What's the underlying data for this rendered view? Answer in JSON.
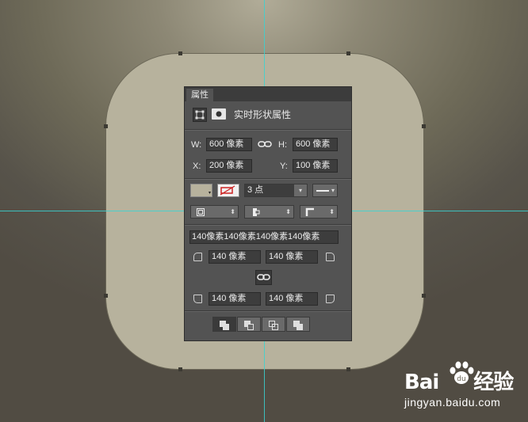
{
  "panel": {
    "tab_label": "属性",
    "header_title": "实时形状属性",
    "w_label": "W:",
    "w_value": "600 像素",
    "h_label": "H:",
    "h_value": "600 像素",
    "x_label": "X:",
    "x_value": "200 像素",
    "y_label": "Y:",
    "y_value": "100 像素",
    "fill_color": "#b7b29d",
    "stroke_width": "3 点",
    "corner_all": "140像素140像素140像素140像素",
    "corner_tl": "140 像素",
    "corner_tr": "140 像素",
    "corner_bl": "140 像素",
    "corner_br": "140 像素"
  },
  "watermark": {
    "logo_text": "Bai",
    "logo_du": "du",
    "logo_jy": "经验",
    "url": "jingyan.baidu.com"
  },
  "colors": {
    "guide": "#39d2d2",
    "shape_fill": "#b7b29d",
    "panel_bg": "#535353"
  }
}
